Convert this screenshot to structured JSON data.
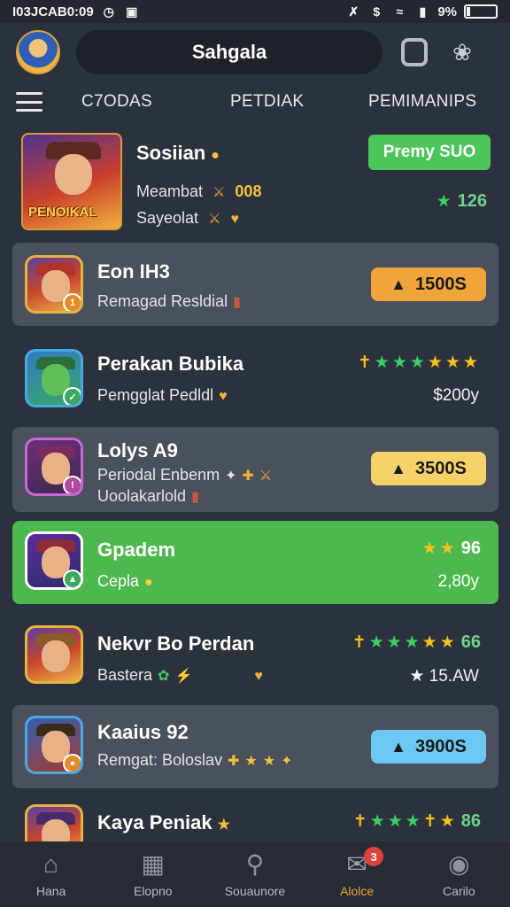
{
  "status": {
    "time_text": "I03JCAB0:09",
    "battery": "9%"
  },
  "header": {
    "title": "Sahgala"
  },
  "tabs": [
    "C7ODAS",
    "PETDIAK",
    "PEMIMANIPS"
  ],
  "featured": {
    "name": "Sosiian",
    "line1_label": "Meambat",
    "line1_value": "008",
    "line2_label": "Sayeolat",
    "thumb_text": "PENOIKAL",
    "button": "Premy SUO",
    "rating": "126"
  },
  "items": [
    {
      "title": "Eon IH3",
      "sub": "Remagad Resldial",
      "pill": "1500S",
      "pill_color": "#f0a53a",
      "badge": "1"
    },
    {
      "title": "Perakan Bubika",
      "sub": "Pemgglat Pedldl",
      "price": "$200y"
    },
    {
      "title": "Lolys A9",
      "sub": "Periodal Enbenm",
      "sub2": "Uoolakarlold",
      "pill": "3500S",
      "pill_color": "#f6d36a"
    },
    {
      "title": "Gpadem",
      "sub": "Cepla",
      "rating": "96",
      "price": "2,80y"
    },
    {
      "title": "Nekvr Bo Perdan",
      "sub": "Bastera",
      "rating": "66",
      "price": "15.AW"
    },
    {
      "title": "Kaaius 92",
      "sub": "Remgat: Boloslav",
      "pill": "3900S",
      "pill_color": "#6cc7f2"
    },
    {
      "title": "Kaya Peniak",
      "rating": "86"
    }
  ],
  "nav": [
    {
      "label": "Hana",
      "icon": "home-icon"
    },
    {
      "label": "Elopno",
      "icon": "gallery-icon"
    },
    {
      "label": "Souaunore",
      "icon": "search-icon"
    },
    {
      "label": "Alolce",
      "icon": "messages-icon",
      "badge": "3"
    },
    {
      "label": "Carilo",
      "icon": "camera-icon"
    }
  ],
  "colors": {
    "accent_green": "#4cb84e",
    "accent_orange": "#f0a23c"
  }
}
